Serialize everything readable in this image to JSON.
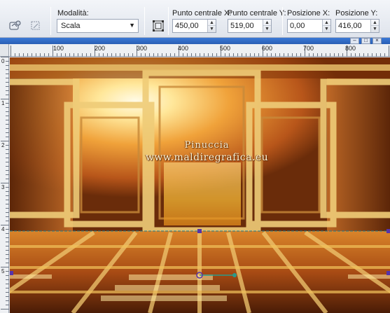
{
  "toolbar": {
    "mode_label": "Modalità:",
    "mode_value": "Scala",
    "fields": [
      {
        "label": "Punto centrale X:",
        "value": "450,00"
      },
      {
        "label": "Punto centrale Y:",
        "value": "519,00"
      },
      {
        "label": "Posizione X:",
        "value": "0,00"
      },
      {
        "label": "Posizione Y:",
        "value": "416,00"
      }
    ],
    "icons": [
      "presets-icon",
      "reset-icon",
      "mode-scale-icon"
    ]
  },
  "ruler": {
    "labels": [
      "100",
      "200",
      "300",
      "400",
      "500",
      "600",
      "700",
      "800"
    ],
    "vertical_labels": [
      "0",
      "1",
      "2",
      "3",
      "4",
      "5"
    ]
  },
  "canvas": {
    "watermark_line1": "Pinuccia",
    "watermark_line2": "www.maldiregrafica.eu",
    "colors": {
      "dark": "#5a2a08",
      "orange": "#e08a1a",
      "gold": "#f2c25a",
      "pale": "#fff2b0"
    }
  },
  "window": {
    "title_fragment": "",
    "buttons": [
      "minimize-icon",
      "maximize-icon",
      "close-icon"
    ]
  }
}
